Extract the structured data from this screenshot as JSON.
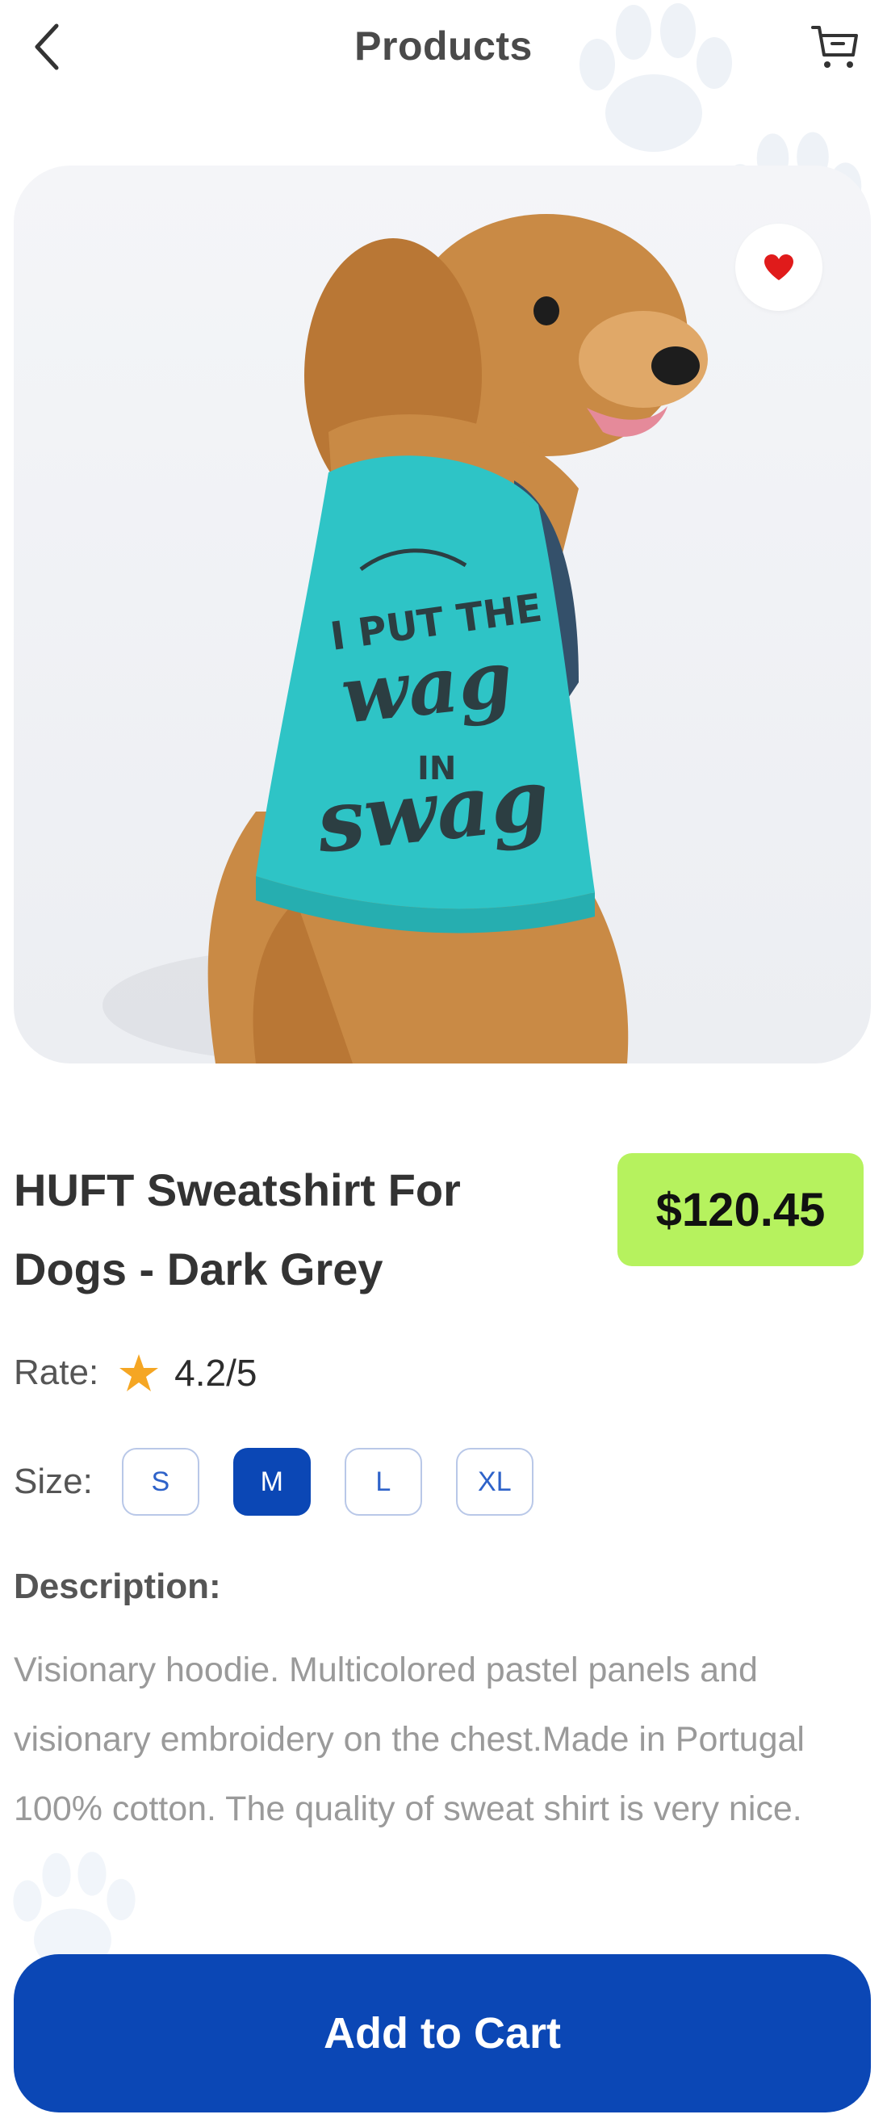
{
  "header": {
    "title": "Products",
    "back_icon": "chevron-left-icon",
    "cart_icon": "shopping-cart-icon"
  },
  "product": {
    "name": "HUFT Sweatshirt For Dogs - Dark Grey",
    "price": "$120.45",
    "favorite": true,
    "image_shirt_text": [
      "I PUT THE",
      "wag",
      "IN",
      "swag"
    ]
  },
  "rating": {
    "label": "Rate:",
    "value": "4.2/5"
  },
  "size": {
    "label": "Size:",
    "options": [
      "S",
      "M",
      "L",
      "XL"
    ],
    "selected": "M"
  },
  "description": {
    "title": "Description:",
    "text": "Visionary hoodie. Multicolored pastel panels and visionary embroidery on the chest.Made in Portugal 100% cotton. The quality of sweat shirt is very nice."
  },
  "actions": {
    "add_to_cart_label": "Add to Cart"
  },
  "colors": {
    "primary": "#0b47b5",
    "price_badge": "#b6f25e",
    "star": "#f5a623",
    "heart": "#e01b1b",
    "shirt": "#2ec4c6"
  }
}
